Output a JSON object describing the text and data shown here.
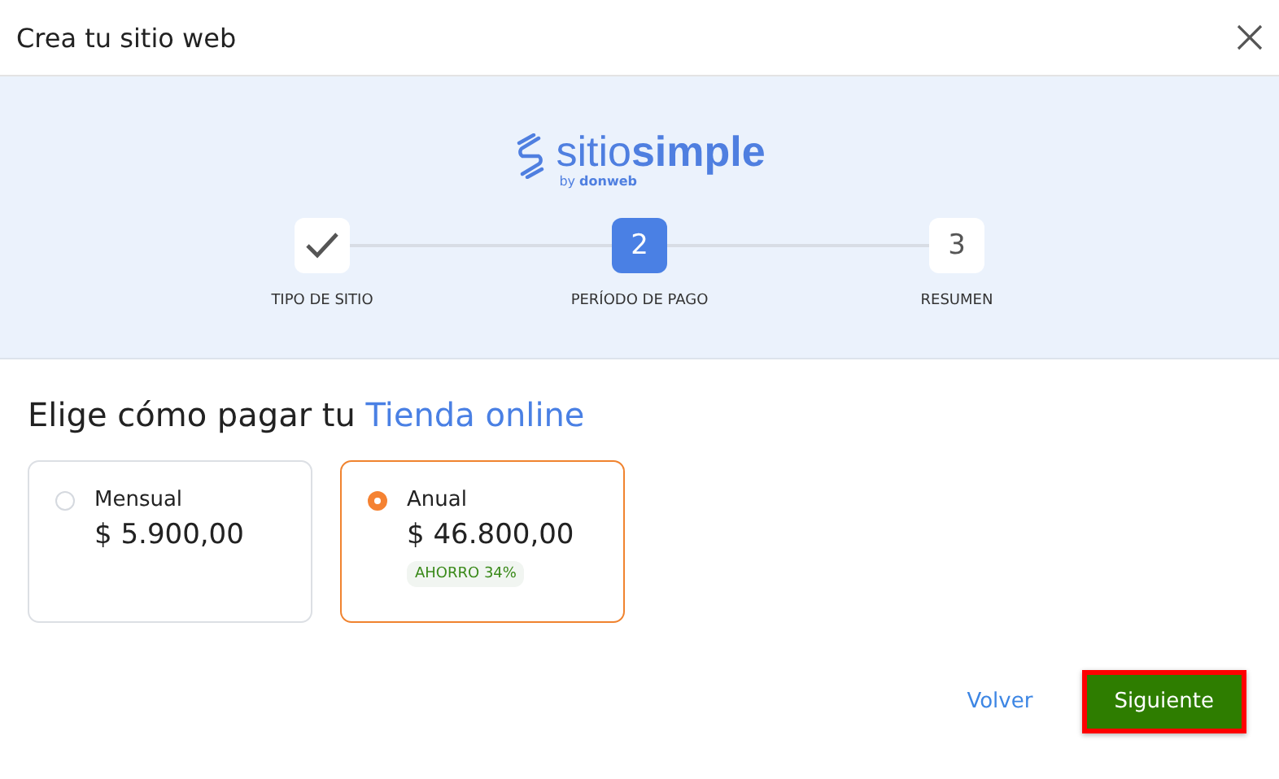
{
  "window": {
    "title": "Crea tu sitio web"
  },
  "logo": {
    "name": "sitio**simple**",
    "byline": "by **donweb**"
  },
  "steps": [
    {
      "label": "TIPO DE SITIO",
      "kind": "done"
    },
    {
      "label": "PERÍODO DE PAGO",
      "kind": "current",
      "number": "2"
    },
    {
      "label": "RESUMEN",
      "kind": "pending",
      "number": "3"
    }
  ],
  "heading": {
    "prefix": "Elige cómo pagar tu",
    "highlight": "Tienda online"
  },
  "plans": [
    {
      "name": "Mensual",
      "price": "$ 5.900,00",
      "selected": false
    },
    {
      "name": "Anual",
      "price": "$ 46.800,00",
      "badge": "AHORRO 34%",
      "selected": true
    }
  ],
  "buttons": {
    "back": "Volver",
    "next": "Siguiente"
  }
}
